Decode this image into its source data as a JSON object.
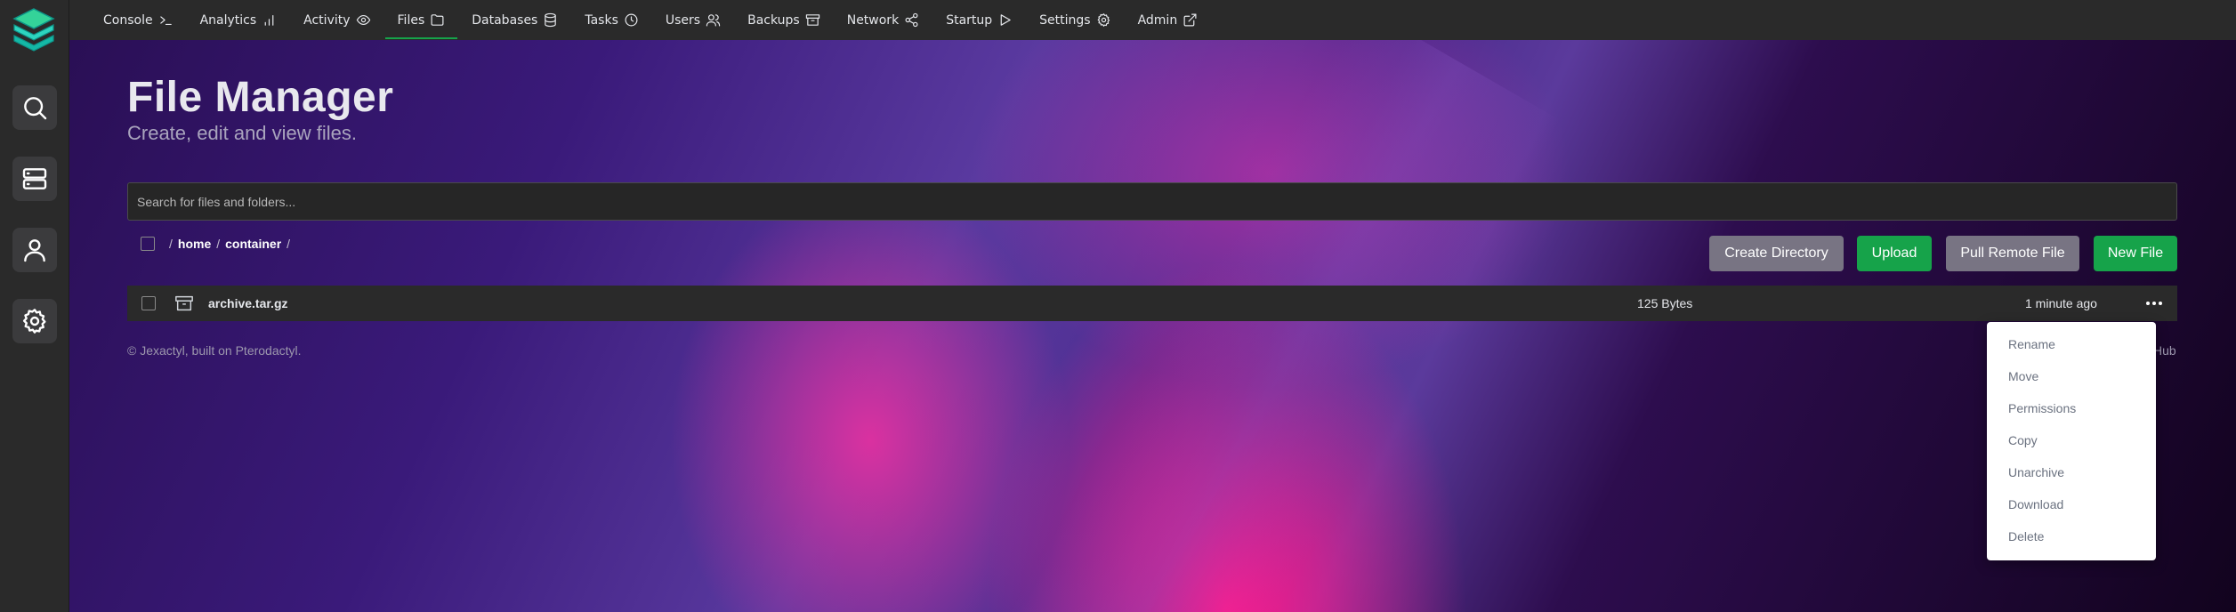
{
  "nav": {
    "items": [
      {
        "label": "Console",
        "icon": "terminal-icon"
      },
      {
        "label": "Analytics",
        "icon": "bar-chart-icon"
      },
      {
        "label": "Activity",
        "icon": "eye-icon"
      },
      {
        "label": "Files",
        "icon": "folder-icon",
        "active": true
      },
      {
        "label": "Databases",
        "icon": "database-icon"
      },
      {
        "label": "Tasks",
        "icon": "clock-icon"
      },
      {
        "label": "Users",
        "icon": "users-icon"
      },
      {
        "label": "Backups",
        "icon": "archive-icon"
      },
      {
        "label": "Network",
        "icon": "share-icon"
      },
      {
        "label": "Startup",
        "icon": "play-icon"
      },
      {
        "label": "Settings",
        "icon": "gear-icon"
      },
      {
        "label": "Admin",
        "icon": "external-link-icon"
      }
    ]
  },
  "sidebar": {
    "items": [
      {
        "icon": "search-icon"
      },
      {
        "icon": "server-icon"
      },
      {
        "icon": "user-icon"
      },
      {
        "icon": "gear-icon"
      }
    ]
  },
  "page": {
    "title": "File Manager",
    "subtitle": "Create, edit and view files."
  },
  "search": {
    "placeholder": "Search for files and folders..."
  },
  "breadcrumb": {
    "root_sep": "/",
    "parts": [
      "home",
      "container"
    ],
    "sep": "/"
  },
  "actions": {
    "create_directory": "Create Directory",
    "upload": "Upload",
    "pull_remote": "Pull Remote File",
    "new_file": "New File"
  },
  "files": [
    {
      "name": "archive.tar.gz",
      "size": "125 Bytes",
      "modified": "1 minute ago"
    }
  ],
  "footer": {
    "left": "© Jexactyl, built on Pterodactyl.",
    "right": "Hub"
  },
  "context_menu": {
    "items": [
      "Rename",
      "Move",
      "Permissions",
      "Copy",
      "Unarchive",
      "Download",
      "Delete"
    ]
  },
  "colors": {
    "accent": "#16a34a",
    "secondary_button": "#787483",
    "panel": "#2a2a2a"
  }
}
